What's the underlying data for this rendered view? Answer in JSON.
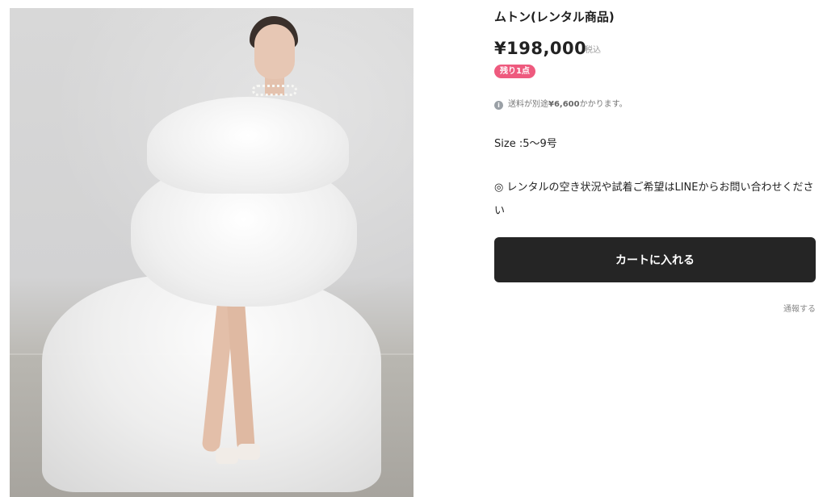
{
  "product": {
    "image_alt": "product-photo",
    "title": "ムトン(レンタル商品)",
    "price": "¥198,000",
    "tax_label": "税込",
    "stock_badge": "残り1点",
    "shipping_prefix": "送料が別途",
    "shipping_amount": "¥6,600",
    "shipping_suffix": "かかります。",
    "size": "Size :5〜9号",
    "notice": "◎ レンタルの空き状況や試着ご希望はLINEからお問い合わせください",
    "cart_button_label": "カートに入れる",
    "report_link": "通報する"
  },
  "colors": {
    "badge": "#ee5a7e",
    "cart_button": "#252525"
  },
  "icons": {
    "shipping_info": "info-icon"
  }
}
